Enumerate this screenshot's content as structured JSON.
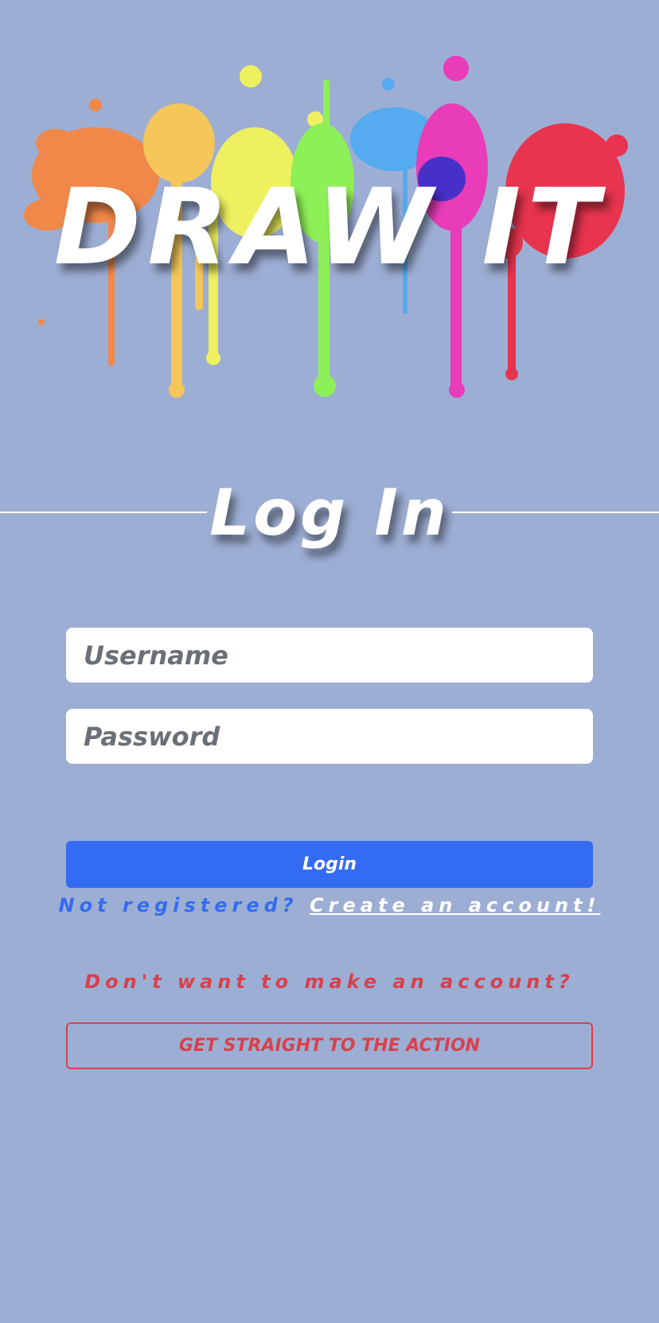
{
  "logo": {
    "text": "DRAW IT",
    "splat_colors": [
      "#f0884a",
      "#f5c65a",
      "#eef060",
      "#8ef058",
      "#55aaf0",
      "#e83cb8",
      "#e8344e"
    ]
  },
  "heading": {
    "title": "Log In"
  },
  "form": {
    "username_placeholder": "Username",
    "password_placeholder": "Password",
    "login_label": "Login"
  },
  "register": {
    "question": "Not registered?",
    "link": "Create an account!"
  },
  "guest": {
    "question": "Don't want to make an account?",
    "button_label": "GET STRAIGHT TO THE ACTION"
  },
  "colors": {
    "background": "#9daed4",
    "primary": "#336cf2",
    "danger": "#d9404c"
  }
}
